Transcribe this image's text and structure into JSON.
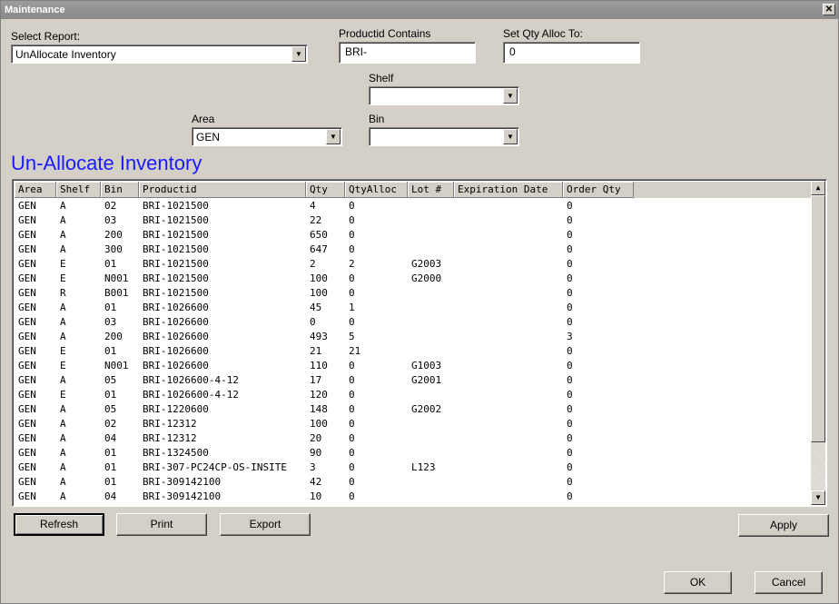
{
  "window": {
    "title": "Maintenance",
    "close_glyph": "✕"
  },
  "filters": {
    "select_report_label": "Select Report:",
    "select_report_value": "UnAllocate Inventory",
    "productid_label": "Productid Contains",
    "productid_value": "BRI-",
    "set_qty_label": "Set Qty Alloc To:",
    "set_qty_value": "0",
    "shelf_label": "Shelf",
    "shelf_value": "",
    "area_label": "Area",
    "area_value": "GEN",
    "bin_label": "Bin",
    "bin_value": ""
  },
  "section_title": "Un-Allocate Inventory",
  "grid": {
    "columns": [
      "Area",
      "Shelf",
      "Bin",
      "Productid",
      "Qty",
      "QtyAlloc",
      "Lot #",
      "Expiration Date",
      "Order Qty"
    ],
    "rows": [
      [
        "GEN",
        "A",
        "02",
        "BRI-1021500",
        "4",
        "0",
        "",
        "",
        "0"
      ],
      [
        "GEN",
        "A",
        "03",
        "BRI-1021500",
        "22",
        "0",
        "",
        "",
        "0"
      ],
      [
        "GEN",
        "A",
        "200",
        "BRI-1021500",
        "650",
        "0",
        "",
        "",
        "0"
      ],
      [
        "GEN",
        "A",
        "300",
        "BRI-1021500",
        "647",
        "0",
        "",
        "",
        "0"
      ],
      [
        "GEN",
        "E",
        "01",
        "BRI-1021500",
        "2",
        "2",
        "G2003",
        "",
        "0"
      ],
      [
        "GEN",
        "E",
        "N001",
        "BRI-1021500",
        "100",
        "0",
        "G2000",
        "",
        "0"
      ],
      [
        "GEN",
        "R",
        "B001",
        "BRI-1021500",
        "100",
        "0",
        "",
        "",
        "0"
      ],
      [
        "GEN",
        "A",
        "01",
        "BRI-1026600",
        "45",
        "1",
        "",
        "",
        "0"
      ],
      [
        "GEN",
        "A",
        "03",
        "BRI-1026600",
        "0",
        "0",
        "",
        "",
        "0"
      ],
      [
        "GEN",
        "A",
        "200",
        "BRI-1026600",
        "493",
        "5",
        "",
        "",
        "3"
      ],
      [
        "GEN",
        "E",
        "01",
        "BRI-1026600",
        "21",
        "21",
        "",
        "",
        "0"
      ],
      [
        "GEN",
        "E",
        "N001",
        "BRI-1026600",
        "110",
        "0",
        "G1003",
        "",
        "0"
      ],
      [
        "GEN",
        "A",
        "05",
        "BRI-1026600-4-12",
        "17",
        "0",
        "G2001",
        "",
        "0"
      ],
      [
        "GEN",
        "E",
        "01",
        "BRI-1026600-4-12",
        "120",
        "0",
        "",
        "",
        "0"
      ],
      [
        "GEN",
        "A",
        "05",
        "BRI-1220600",
        "148",
        "0",
        "G2002",
        "",
        "0"
      ],
      [
        "GEN",
        "A",
        "02",
        "BRI-12312",
        "100",
        "0",
        "",
        "",
        "0"
      ],
      [
        "GEN",
        "A",
        "04",
        "BRI-12312",
        "20",
        "0",
        "",
        "",
        "0"
      ],
      [
        "GEN",
        "A",
        "01",
        "BRI-1324500",
        "90",
        "0",
        "",
        "",
        "0"
      ],
      [
        "GEN",
        "A",
        "01",
        "BRI-307-PC24CP-OS-INSITE",
        "3",
        "0",
        "L123",
        "",
        "0"
      ],
      [
        "GEN",
        "A",
        "01",
        "BRI-309142100",
        "42",
        "0",
        "",
        "",
        "0"
      ],
      [
        "GEN",
        "A",
        "04",
        "BRI-309142100",
        "10",
        "0",
        "",
        "",
        "0"
      ]
    ]
  },
  "buttons": {
    "refresh": "Refresh",
    "print": "Print",
    "export": "Export",
    "apply": "Apply",
    "ok": "OK",
    "cancel": "Cancel"
  },
  "icons": {
    "dropdown_arrow": "▼",
    "scroll_up": "▲",
    "scroll_down": "▼"
  },
  "colors": {
    "section_title": "#1a1aff",
    "window_bg": "#d4d0c8"
  }
}
